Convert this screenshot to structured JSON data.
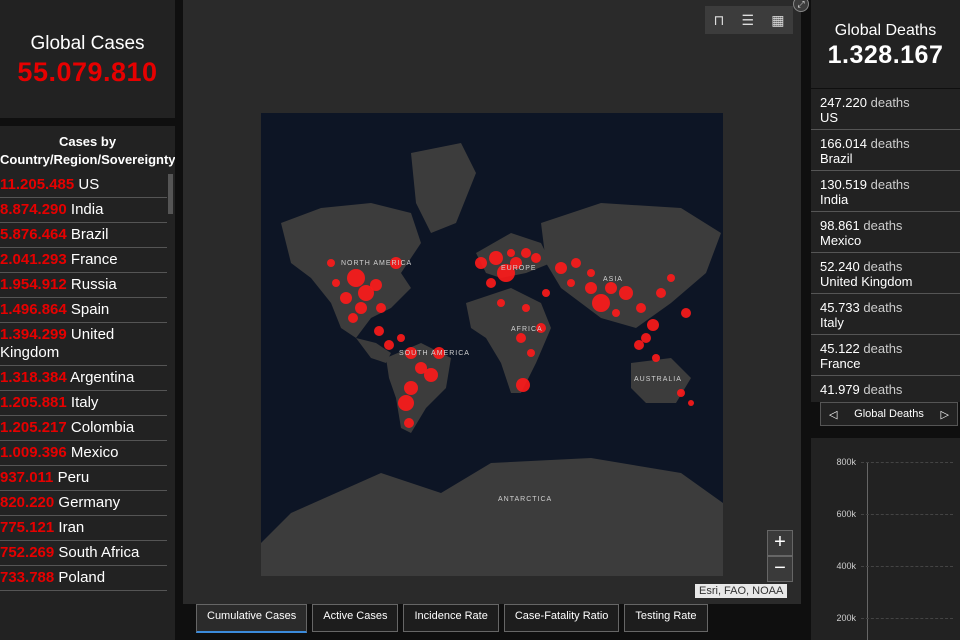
{
  "global_cases": {
    "title": "Global Cases",
    "value": "55.079.810"
  },
  "cases_list": {
    "header": "Cases by Country/Region/Sovereignty",
    "rows": [
      {
        "num": "11.205.485",
        "name": "US"
      },
      {
        "num": "8.874.290",
        "name": "India"
      },
      {
        "num": "5.876.464",
        "name": "Brazil"
      },
      {
        "num": "2.041.293",
        "name": "France"
      },
      {
        "num": "1.954.912",
        "name": "Russia"
      },
      {
        "num": "1.496.864",
        "name": "Spain"
      },
      {
        "num": "1.394.299",
        "name": "United Kingdom"
      },
      {
        "num": "1.318.384",
        "name": "Argentina"
      },
      {
        "num": "1.205.881",
        "name": "Italy"
      },
      {
        "num": "1.205.217",
        "name": "Colombia"
      },
      {
        "num": "1.009.396",
        "name": "Mexico"
      },
      {
        "num": "937.011",
        "name": "Peru"
      },
      {
        "num": "820.220",
        "name": "Germany"
      },
      {
        "num": "775.121",
        "name": "Iran"
      },
      {
        "num": "752.269",
        "name": "South Africa"
      },
      {
        "num": "733.788",
        "name": "Poland"
      }
    ]
  },
  "map": {
    "labels": {
      "north_america": "NORTH AMERICA",
      "south_america": "SOUTH AMERICA",
      "europe": "EUROPE",
      "africa": "AFRICA",
      "asia": "ASIA",
      "australia": "AUSTRALIA",
      "antarctica": "ANTARCTICA"
    },
    "attribution": "Esri, FAO, NOAA",
    "zoom_in": "+",
    "zoom_out": "−",
    "toolbar_icons": [
      "bookmark-icon",
      "legend-list-icon",
      "qr-grid-icon"
    ]
  },
  "tabs": [
    "Cumulative Cases",
    "Active Cases",
    "Incidence Rate",
    "Case-Fatality Ratio",
    "Testing Rate"
  ],
  "global_deaths": {
    "title": "Global Deaths",
    "value": "1.328.167"
  },
  "deaths_list": {
    "unit": "deaths",
    "rows": [
      {
        "num": "247.220",
        "country": "US"
      },
      {
        "num": "166.014",
        "country": "Brazil"
      },
      {
        "num": "130.519",
        "country": "India"
      },
      {
        "num": "98.861",
        "country": "Mexico"
      },
      {
        "num": "52.240",
        "country": "United Kingdom"
      },
      {
        "num": "45.733",
        "country": "Italy"
      },
      {
        "num": "45.122",
        "country": "France"
      },
      {
        "num": "41.979",
        "country": ""
      }
    ]
  },
  "deaths_nav": {
    "label": "Global Deaths",
    "prev": "◁",
    "next": "▷"
  },
  "deaths_chart": {
    "ticks": [
      "800k",
      "600k",
      "400k",
      "200k"
    ]
  },
  "colors": {
    "accent_red": "#e60000",
    "panel": "#222222",
    "ocean": "#0d1525",
    "land": "#3a3a3a"
  }
}
